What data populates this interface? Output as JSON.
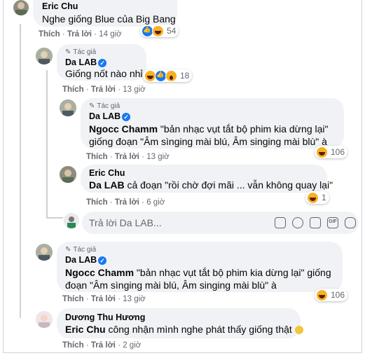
{
  "comments": [
    {
      "name": "Eric Chu",
      "text": "Nghe giống Blue của Big Bang",
      "like": "Thích",
      "reply": "Trả lời",
      "time": "14 giờ",
      "reactions": 54
    },
    {
      "author_tag": "Tác giả",
      "name": "Da LAB",
      "text": "Giống nốt nào nhỉ",
      "like": "Thích",
      "reply": "Trả lời",
      "time": "13 giờ",
      "reactions": 18
    },
    {
      "author_tag": "Tác giả",
      "name": "Da LAB",
      "mention": "Ngocc Chamm",
      "text_line1": "\"bản nhạc vụt tắt bộ phim kia dừng lại\"",
      "text_line2": "giống đoạn \"Âm sìnging mài blú, Âm singing mài blù\" à",
      "like": "Thích",
      "reply": "Trả lời",
      "time": "13 giờ",
      "reactions": 106
    },
    {
      "name": "Eric Chu",
      "mention": "Da LAB",
      "text": "cả đoạn \"rồi chờ đợi mãi ... vẫn không quay lại\"",
      "like": "Thích",
      "reply": "Trả lời",
      "time": "6 giờ",
      "reactions": 1
    },
    {
      "author_tag": "Tác giả",
      "name": "Da LAB",
      "mention": "Ngocc Chamm",
      "text_line1": "\"bản nhạc vụt tắt bộ phim kia dừng lại\" giống",
      "text_line2": "đoạn \"Âm sìnging mài blú, Âm singing mài blù\" à",
      "like": "Thích",
      "reply": "Trả lời",
      "time": "13 giờ",
      "reactions": 106
    },
    {
      "name": "Dương Thu Hương",
      "mention": "Eric Chu",
      "text": "công nhận mình nghe phát thấy giống thật",
      "like": "Thích",
      "reply": "Trả lời",
      "time": "2 giờ"
    }
  ],
  "reply_box": {
    "placeholder": "Trả lời Da LAB..."
  },
  "separator": "·",
  "colors": {
    "bubble": "#f0f2f5",
    "meta": "#65676b",
    "verified": "#1877f2"
  }
}
